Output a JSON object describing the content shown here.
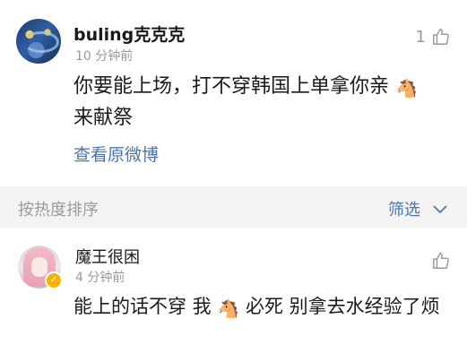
{
  "post": {
    "username": "buling克克克",
    "time": "10 分钟前",
    "like_count": "1",
    "text_before": "你要能上场，打不穿韩国上单拿你亲",
    "emoji": "🐴",
    "text_after": "来献祭",
    "view_original": "查看原微博"
  },
  "sortbar": {
    "label": "按热度排序",
    "filter_label": "筛选"
  },
  "reply": {
    "username": "魔王很困",
    "time": "4 分钟前",
    "text_before": "能上的话不穿 我",
    "emoji": "🐴",
    "text_after": " 必死 别拿去水经验了烦"
  },
  "colors": {
    "link": "#4a76a8",
    "muted": "#9a9a9a",
    "sort_bg": "#f3f3f3"
  }
}
